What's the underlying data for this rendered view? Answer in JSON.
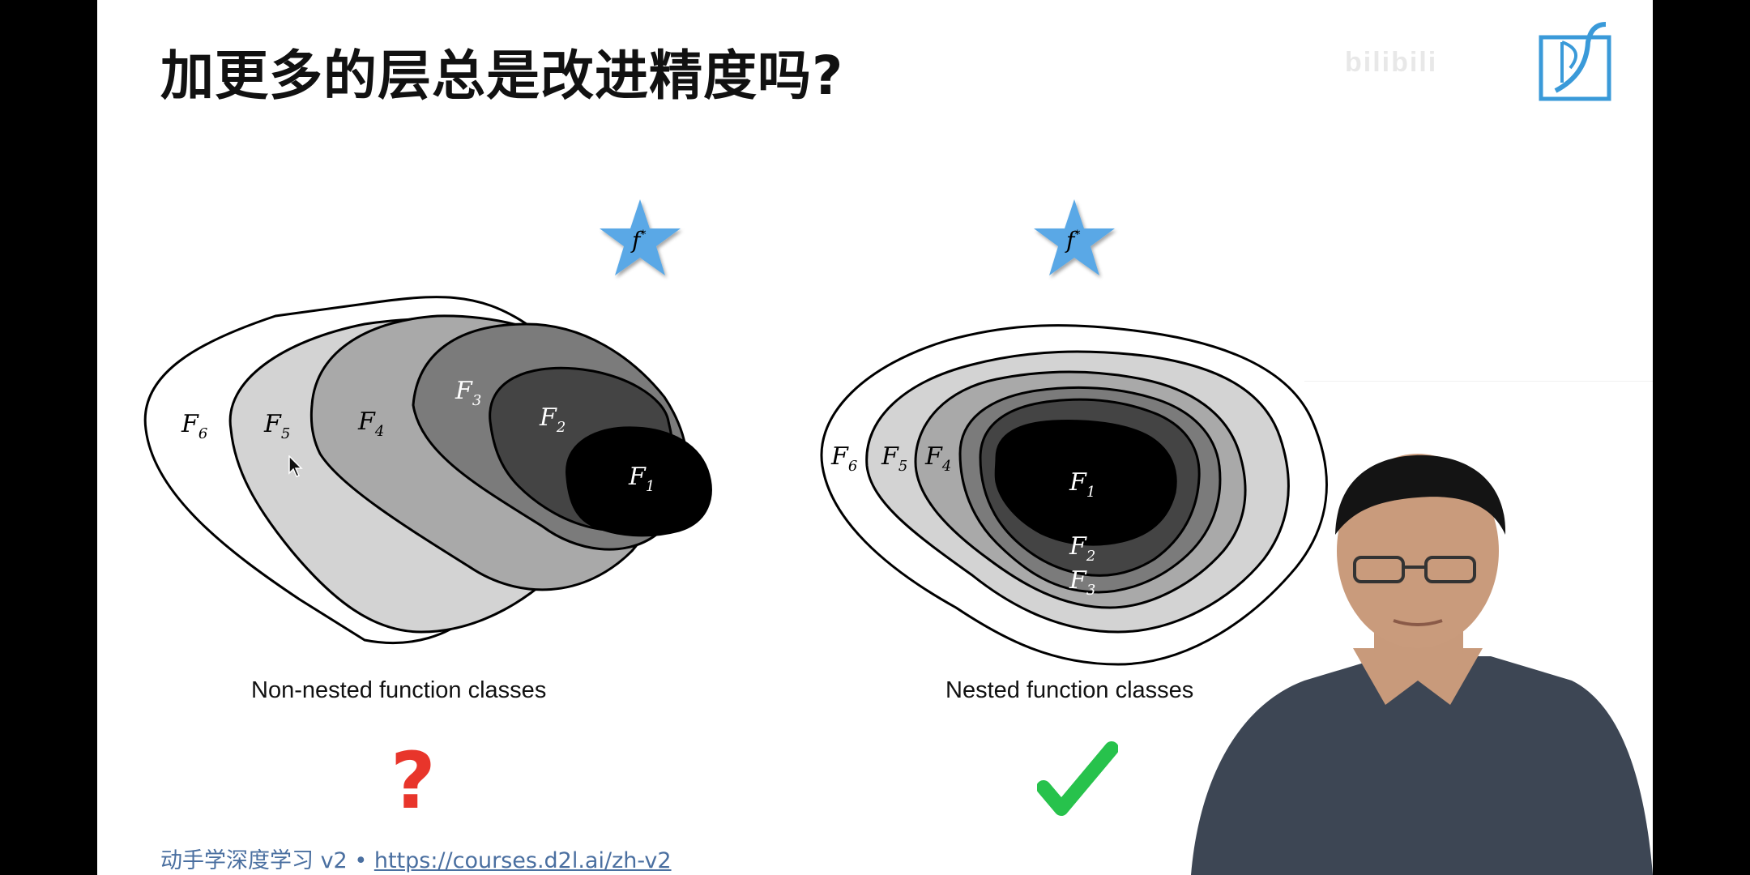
{
  "slide": {
    "title": "加更多的层总是改进精度吗?",
    "logo_text": "bilibili",
    "footer_text": "动手学深度学习 v2 • ",
    "footer_link": "https://courses.d2l.ai/zh-v2"
  },
  "figure": {
    "left": {
      "caption": "Non-nested function classes",
      "star_label": "f",
      "star_sup": "*",
      "labels": [
        {
          "name": "F",
          "sub": "6"
        },
        {
          "name": "F",
          "sub": "5"
        },
        {
          "name": "F",
          "sub": "4"
        },
        {
          "name": "F",
          "sub": "3"
        },
        {
          "name": "F",
          "sub": "2"
        },
        {
          "name": "F",
          "sub": "1"
        }
      ],
      "verdict": "?"
    },
    "right": {
      "caption": "Nested function classes",
      "star_label": "f",
      "star_sup": "*",
      "labels": [
        {
          "name": "F",
          "sub": "6"
        },
        {
          "name": "F",
          "sub": "5"
        },
        {
          "name": "F",
          "sub": "4"
        },
        {
          "name": "F",
          "sub": "1"
        },
        {
          "name": "F",
          "sub": "2"
        },
        {
          "name": "F",
          "sub": "3"
        }
      ],
      "verdict": "✔"
    }
  },
  "colors": {
    "star": "#5aa8e6",
    "question": "#e8352b",
    "check": "#27c24c",
    "link": "#4a6fa0"
  }
}
